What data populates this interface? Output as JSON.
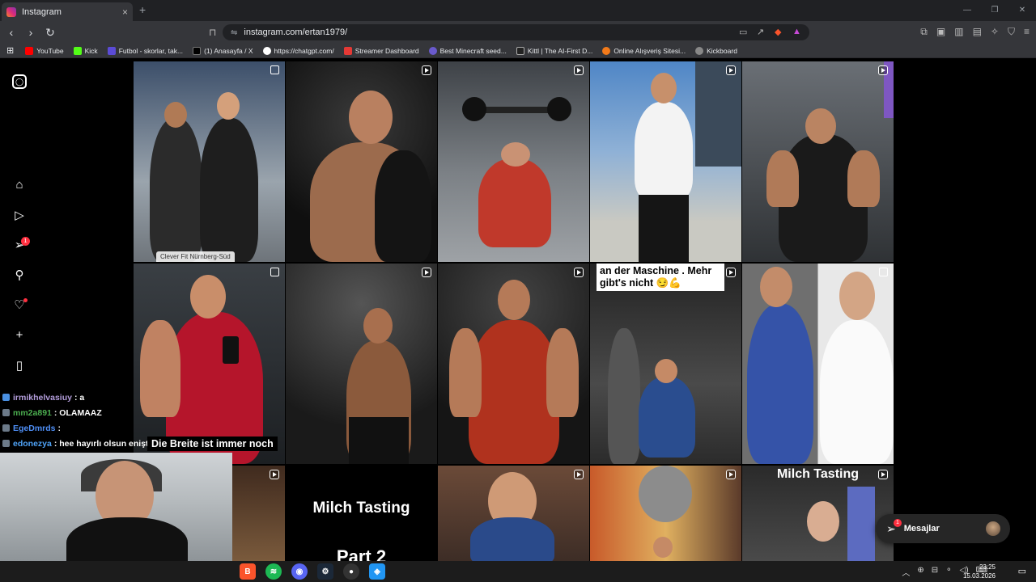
{
  "browser": {
    "tab_title": "Instagram",
    "tab_close": "×",
    "new_tab": "+",
    "url": "instagram.com/ertan1979/",
    "bookmarks": [
      {
        "label": "YouTube",
        "color": "#ff0000"
      },
      {
        "label": "Kick",
        "color": "#53fc18"
      },
      {
        "label": "Futbol - skorlar, tak...",
        "color": "#5b4bd6"
      },
      {
        "label": "(1) Anasayfa / X",
        "color": "#000000"
      },
      {
        "label": "https://chatgpt.com/",
        "color": "#ffffff"
      },
      {
        "label": "Streamer Dashboard",
        "color": "#e53935"
      },
      {
        "label": "Best Minecraft seed...",
        "color": "#6a5acd"
      },
      {
        "label": "Kittl | The AI-First D...",
        "color": "#222222"
      },
      {
        "label": "Online Alışveriş Sitesi...",
        "color": "#f27a1a"
      },
      {
        "label": "Kickboard",
        "color": "#888888"
      }
    ]
  },
  "ig_sidebar": {
    "icons": [
      "instagram-icon",
      "home-icon",
      "reels-icon",
      "direct-icon",
      "search-icon",
      "heart-icon",
      "create-icon",
      "dashboard-icon"
    ],
    "direct_badge": "1"
  },
  "grid": {
    "location_tag": "Clever Fit Nürnberg-Süd",
    "caption_maschine": "an der Maschine . Mehr gibt's nicht 😏💪",
    "caption_breite": "Die Breite ist immer noch",
    "title_milch": "Milch Tasting",
    "title_milch_2": "Milch Tasting",
    "title_part": "Part 2"
  },
  "chat": [
    {
      "user": "irmikhelvasiuy",
      "color": "#b39ddb",
      "message": ": a"
    },
    {
      "user": "mm2a891",
      "color": "#4caf50",
      "message": ": OLAMAAZ"
    },
    {
      "user": "EgeDmrds",
      "color": "#4f8ff7",
      "message": ":"
    },
    {
      "user": "edonezya",
      "color": "#4fa3f7",
      "message": ": hee hayırlı olsun enişte"
    }
  ],
  "messages_pill": {
    "label": "Mesajlar",
    "badge": "1"
  },
  "taskbar": {
    "time": "23:25",
    "date": "15.03.2026"
  }
}
